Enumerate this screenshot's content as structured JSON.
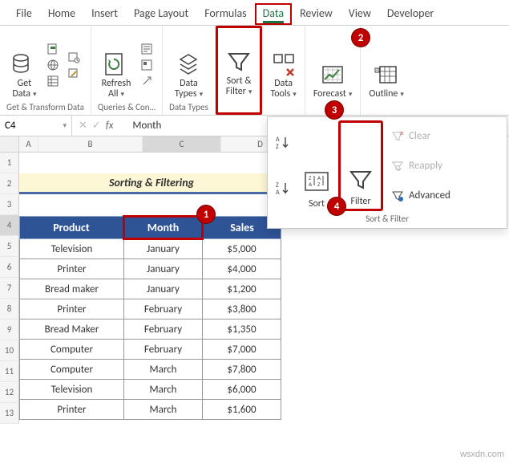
{
  "tabs": {
    "file": "File",
    "home": "Home",
    "insert": "Insert",
    "page_layout": "Page Layout",
    "formulas": "Formulas",
    "data": "Data",
    "review": "Review",
    "view": "View",
    "developer": "Developer"
  },
  "ribbon": {
    "get_data": "Get\nData",
    "refresh_all": "Refresh\nAll",
    "data_types": "Data\nTypes",
    "sort_filter": "Sort &\nFilter",
    "data_tools": "Data\nTools",
    "forecast": "Forecast",
    "outline": "Outline",
    "grp_get": "Get & Transform Data",
    "grp_qc": "Queries & Con…",
    "grp_types": "Data Types"
  },
  "popout": {
    "sort": "Sort",
    "filter": "Filter",
    "clear": "Clear",
    "reapply": "Reapply",
    "advanced": "Advanced",
    "group": "Sort & Filter"
  },
  "fbar": {
    "name": "C4",
    "value": "Month"
  },
  "colhdrs": {
    "a": "A",
    "b": "B",
    "c": "C",
    "d": "D"
  },
  "rowhdrs": [
    "1",
    "2",
    "3",
    "4",
    "5",
    "6",
    "7",
    "8",
    "9",
    "10",
    "11",
    "12",
    "13"
  ],
  "title": "Sorting & Filtering",
  "thead": {
    "product": "Product",
    "month": "Month",
    "sales": "Sales"
  },
  "rows": [
    {
      "p": "Television",
      "m": "January",
      "s": "$5,000"
    },
    {
      "p": "Printer",
      "m": "January",
      "s": "$4,000"
    },
    {
      "p": "Bread maker",
      "m": "January",
      "s": "$1,200"
    },
    {
      "p": "Printer",
      "m": "February",
      "s": "$3,800"
    },
    {
      "p": "Bread Maker",
      "m": "February",
      "s": "$1,350"
    },
    {
      "p": "Computer",
      "m": "February",
      "s": "$7,000"
    },
    {
      "p": "Computer",
      "m": "March",
      "s": "$7,800"
    },
    {
      "p": "Television",
      "m": "March",
      "s": "$6,000"
    },
    {
      "p": "Printer",
      "m": "March",
      "s": "$1,600"
    }
  ],
  "badges": {
    "b1": "1",
    "b2": "2",
    "b3": "3",
    "b4": "4"
  },
  "wm": "wsxdn.com"
}
